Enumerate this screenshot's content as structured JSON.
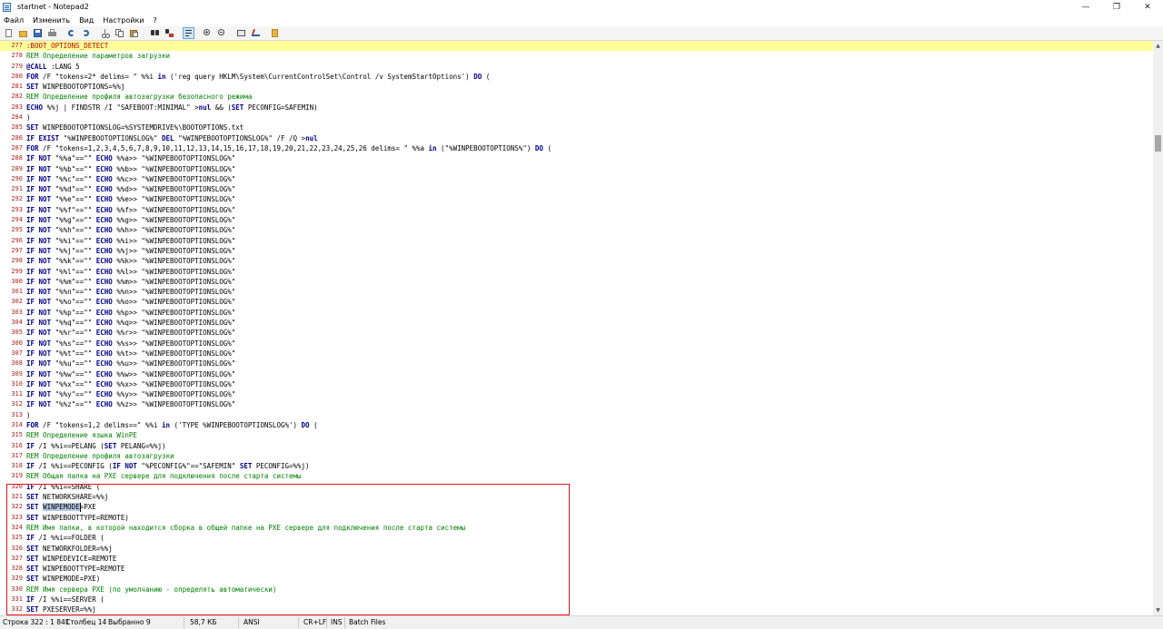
{
  "window": {
    "title": "startnet - Notepad2",
    "min_glyph": "—",
    "max_glyph": "❐",
    "close_glyph": "✕"
  },
  "menu": [
    "Файл",
    "Изменить",
    "Вид",
    "Настройки",
    "?"
  ],
  "toolbar": {
    "buttons": [
      "new-file-icon",
      "open-folder-icon",
      "save-icon",
      "print-icon",
      "undo-icon",
      "redo-icon",
      "cut-icon",
      "copy-icon",
      "paste-icon",
      "find-icon",
      "replace-icon",
      "word-wrap-icon",
      "zoom-in-icon",
      "zoom-out-icon",
      "scheme-icon",
      "settings-icon",
      "favorites-icon"
    ],
    "active": "word-wrap-icon"
  },
  "colors": {
    "line_number": "#b22222",
    "keyword": "#00008b",
    "comment": "#008000",
    "label": "#c00000",
    "current_line": "#ffff99",
    "annotation": "#e2141b"
  },
  "editor": {
    "current_line_number": "277",
    "lines": [
      {
        "n": "277",
        "t": ":BOOT_OPTIONS_DETECT",
        "c": "label"
      },
      {
        "n": "278",
        "t": "REM Определение параметров загрузки",
        "c": "rem"
      },
      {
        "n": "279",
        "t": "@CALL :LANG 5",
        "c": "code"
      },
      {
        "n": "280",
        "t": "FOR /F \"tokens=2* delims= \" %%i in ('reg query HKLM\\System\\CurrentControlSet\\Control /v SystemStartOptions') DO (",
        "c": "code"
      },
      {
        "n": "281",
        "t": "SET WINPEBOOTOPTIONS=%%j",
        "c": "code"
      },
      {
        "n": "282",
        "t": "REM Определение профиля автозагрузки безопасного режима",
        "c": "rem"
      },
      {
        "n": "283",
        "t": "ECHO %%j | FINDSTR /I \"SAFEBOOT:MINIMAL\" >nul && (SET PECONFIG=SAFEMIN)",
        "c": "code"
      },
      {
        "n": "284",
        "t": ")",
        "c": "code"
      },
      {
        "n": "285",
        "t": "SET WINPEBOOTOPTIONSLOG=%SYSTEMDRIVE%\\BOOTOPTIONS.txt",
        "c": "code"
      },
      {
        "n": "286",
        "t": "IF EXIST \"%WINPEBOOTOPTIONSLOG%\" DEL \"%WINPEBOOTOPTIONSLOG%\" /F /Q >nul",
        "c": "code"
      },
      {
        "n": "287",
        "t": "FOR /F \"tokens=1,2,3,4,5,6,7,8,9,10,11,12,13,14,15,16,17,18,19,20,21,22,23,24,25,26 delims= \" %%a in (\"%WINPEBOOTOPTIONS%\") DO (",
        "c": "code"
      },
      {
        "n": "288",
        "t": "IF NOT \"%%a\"==\"\" ECHO %%a>> \"%WINPEBOOTOPTIONSLOG%\"",
        "c": "code"
      },
      {
        "n": "289",
        "t": "IF NOT \"%%b\"==\"\" ECHO %%b>> \"%WINPEBOOTOPTIONSLOG%\"",
        "c": "code"
      },
      {
        "n": "290",
        "t": "IF NOT \"%%c\"==\"\" ECHO %%c>> \"%WINPEBOOTOPTIONSLOG%\"",
        "c": "code"
      },
      {
        "n": "291",
        "t": "IF NOT \"%%d\"==\"\" ECHO %%d>> \"%WINPEBOOTOPTIONSLOG%\"",
        "c": "code"
      },
      {
        "n": "292",
        "t": "IF NOT \"%%e\"==\"\" ECHO %%e>> \"%WINPEBOOTOPTIONSLOG%\"",
        "c": "code"
      },
      {
        "n": "293",
        "t": "IF NOT \"%%f\"==\"\" ECHO %%f>> \"%WINPEBOOTOPTIONSLOG%\"",
        "c": "code"
      },
      {
        "n": "294",
        "t": "IF NOT \"%%g\"==\"\" ECHO %%g>> \"%WINPEBOOTOPTIONSLOG%\"",
        "c": "code"
      },
      {
        "n": "295",
        "t": "IF NOT \"%%h\"==\"\" ECHO %%h>> \"%WINPEBOOTOPTIONSLOG%\"",
        "c": "code"
      },
      {
        "n": "296",
        "t": "IF NOT \"%%i\"==\"\" ECHO %%i>> \"%WINPEBOOTOPTIONSLOG%\"",
        "c": "code"
      },
      {
        "n": "297",
        "t": "IF NOT \"%%j\"==\"\" ECHO %%j>> \"%WINPEBOOTOPTIONSLOG%\"",
        "c": "code"
      },
      {
        "n": "298",
        "t": "IF NOT \"%%k\"==\"\" ECHO %%k>> \"%WINPEBOOTOPTIONSLOG%\"",
        "c": "code"
      },
      {
        "n": "299",
        "t": "IF NOT \"%%l\"==\"\" ECHO %%l>> \"%WINPEBOOTOPTIONSLOG%\"",
        "c": "code"
      },
      {
        "n": "300",
        "t": "IF NOT \"%%m\"==\"\" ECHO %%m>> \"%WINPEBOOTOPTIONSLOG%\"",
        "c": "code"
      },
      {
        "n": "301",
        "t": "IF NOT \"%%n\"==\"\" ECHO %%n>> \"%WINPEBOOTOPTIONSLOG%\"",
        "c": "code"
      },
      {
        "n": "302",
        "t": "IF NOT \"%%o\"==\"\" ECHO %%o>> \"%WINPEBOOTOPTIONSLOG%\"",
        "c": "code"
      },
      {
        "n": "303",
        "t": "IF NOT \"%%p\"==\"\" ECHO %%p>> \"%WINPEBOOTOPTIONSLOG%\"",
        "c": "code"
      },
      {
        "n": "304",
        "t": "IF NOT \"%%q\"==\"\" ECHO %%q>> \"%WINPEBOOTOPTIONSLOG%\"",
        "c": "code"
      },
      {
        "n": "305",
        "t": "IF NOT \"%%r\"==\"\" ECHO %%r>> \"%WINPEBOOTOPTIONSLOG%\"",
        "c": "code"
      },
      {
        "n": "306",
        "t": "IF NOT \"%%s\"==\"\" ECHO %%s>> \"%WINPEBOOTOPTIONSLOG%\"",
        "c": "code"
      },
      {
        "n": "307",
        "t": "IF NOT \"%%t\"==\"\" ECHO %%t>> \"%WINPEBOOTOPTIONSLOG%\"",
        "c": "code"
      },
      {
        "n": "308",
        "t": "IF NOT \"%%u\"==\"\" ECHO %%u>> \"%WINPEBOOTOPTIONSLOG%\"",
        "c": "code"
      },
      {
        "n": "309",
        "t": "IF NOT \"%%w\"==\"\" ECHO %%w>> \"%WINPEBOOTOPTIONSLOG%\"",
        "c": "code"
      },
      {
        "n": "310",
        "t": "IF NOT \"%%x\"==\"\" ECHO %%x>> \"%WINPEBOOTOPTIONSLOG%\"",
        "c": "code"
      },
      {
        "n": "311",
        "t": "IF NOT \"%%y\"==\"\" ECHO %%y>> \"%WINPEBOOTOPTIONSLOG%\"",
        "c": "code"
      },
      {
        "n": "312",
        "t": "IF NOT \"%%z\"==\"\" ECHO %%z>> \"%WINPEBOOTOPTIONSLOG%\"",
        "c": "code"
      },
      {
        "n": "313",
        "t": ")",
        "c": "code"
      },
      {
        "n": "314",
        "t": "FOR /F \"tokens=1,2 delims==\" %%i in ('TYPE %WINPEBOOTOPTIONSLOG%') DO (",
        "c": "code"
      },
      {
        "n": "315",
        "t": "REM Определение языка WinPE",
        "c": "rem"
      },
      {
        "n": "316",
        "t": "IF /I %%i==PELANG (SET PELANG=%%j)",
        "c": "code"
      },
      {
        "n": "317",
        "t": "REM Определение профиля автозагрузки",
        "c": "rem"
      },
      {
        "n": "318",
        "t": "IF /I %%i==PECONFIG (IF NOT \"%PECONFIG%\"==\"SAFEMIN\" SET PECONFIG=%%j)",
        "c": "code"
      },
      {
        "n": "319",
        "t": "REM Общая папка на PXE сервере для подключения после старта системы",
        "c": "rem"
      },
      {
        "n": "320",
        "t": "IF /I %%i==SHARE (",
        "c": "code"
      },
      {
        "n": "321",
        "t": "SET NETWORKSHARE=%%j",
        "c": "code"
      },
      {
        "n": "322",
        "t": "SET WINPEMODE=PXE",
        "c": "code"
      },
      {
        "n": "323",
        "t": "SET WINPEBOOTTYPE=REMOTE)",
        "c": "code"
      },
      {
        "n": "324",
        "t": "REM Имя папки, в которой находится сборка в общей папке на PXE сервере для подключения после старта системы",
        "c": "rem"
      },
      {
        "n": "325",
        "t": "IF /I %%i==FOLDER (",
        "c": "code"
      },
      {
        "n": "326",
        "t": "SET NETWORKFOLDER=%%j",
        "c": "code"
      },
      {
        "n": "327",
        "t": "SET WINPEDEVICE=REMOTE",
        "c": "code"
      },
      {
        "n": "328",
        "t": "SET WINPEBOOTTYPE=REMOTE",
        "c": "code"
      },
      {
        "n": "329",
        "t": "SET WINPEMODE=PXE)",
        "c": "code"
      },
      {
        "n": "330",
        "t": "REM Имя сервера PXE (по умолчанию - определять автоматически)",
        "c": "rem"
      },
      {
        "n": "331",
        "t": "IF /I %%i==SERVER (",
        "c": "code"
      },
      {
        "n": "332",
        "t": "SET PXESERVER=%%j",
        "c": "code"
      }
    ],
    "selection": {
      "line": "322",
      "text": "WINPEMODE"
    }
  },
  "status": {
    "position": "Строка 322 : 1 841",
    "column": "Столбец 14",
    "selected": "Выбранно 9",
    "size": "58,7 КБ",
    "encoding": "ANSI",
    "eol": "CR+LF",
    "mode": "INS",
    "scheme": "Batch Files"
  },
  "scroll": {
    "position_fraction": 0.18
  }
}
